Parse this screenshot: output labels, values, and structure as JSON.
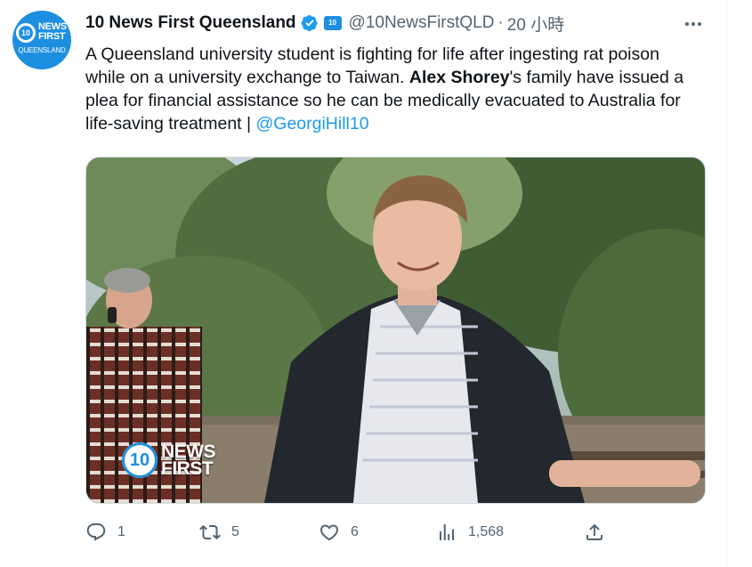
{
  "account": {
    "display_name": "10 News First Queensland",
    "handle": "@10NewsFirstQLD",
    "separator": "·",
    "time": "20 小時",
    "avatar_badge": "10",
    "avatar_line1": "NEWS",
    "avatar_line2": "FIRST",
    "avatar_region": "QUEENSLAND",
    "affiliation_badge": "10",
    "verified_color": "#1d9bf0"
  },
  "tweet": {
    "text_before": "A Queensland university student is fighting for life after ingesting rat poison while on a university exchange to Taiwan. ",
    "bold_name": "Alex Shorey",
    "text_after": "'s family have issued a plea for financial assistance so he can be medically evacuated to Australia for life-saving treatment | ",
    "mention": "@GeorgiHill10"
  },
  "media": {
    "watermark_badge": "10",
    "watermark_line1": "NEWS",
    "watermark_line2": "FIRST"
  },
  "actions": {
    "replies": "1",
    "retweets": "5",
    "likes": "6",
    "views": "1,568"
  },
  "icons": {
    "more": "more-icon",
    "reply": "reply-icon",
    "retweet": "retweet-icon",
    "like": "like-icon",
    "views": "views-icon",
    "share": "share-icon"
  },
  "colors": {
    "accent": "#1d9bf0",
    "muted_text": "#536471",
    "brand": "#1d8fe0"
  }
}
